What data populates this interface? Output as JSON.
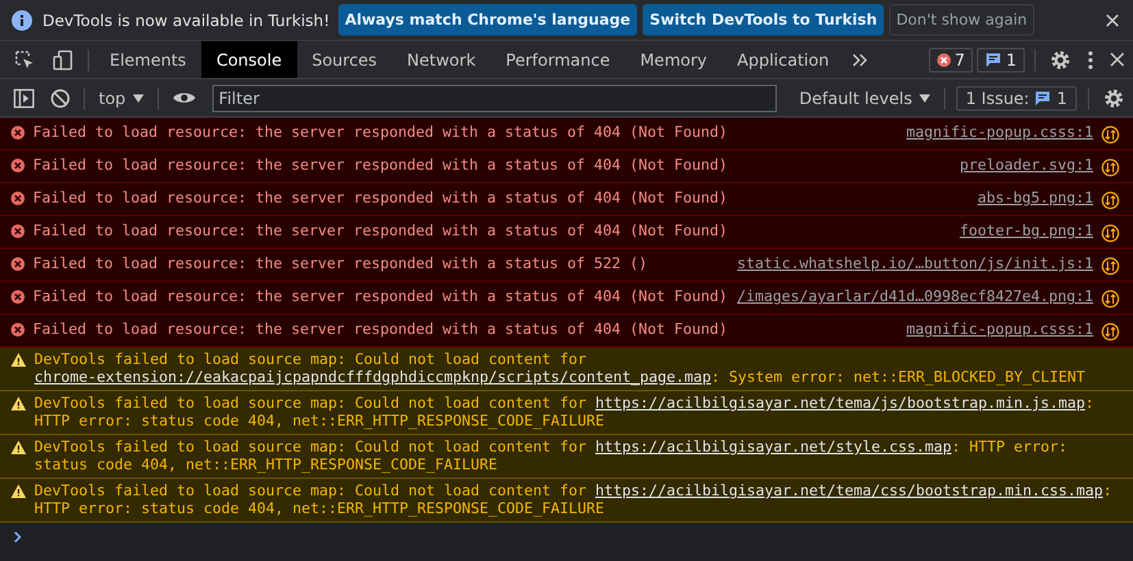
{
  "infobar": {
    "text": "DevTools is now available in Turkish!",
    "buttons": [
      {
        "label": "Always match Chrome's language",
        "kind": "primary"
      },
      {
        "label": "Switch DevTools to Turkish",
        "kind": "primary"
      },
      {
        "label": "Don't show again",
        "kind": "plain"
      }
    ]
  },
  "tabs": [
    {
      "label": "Elements",
      "selected": false
    },
    {
      "label": "Console",
      "selected": true
    },
    {
      "label": "Sources",
      "selected": false
    },
    {
      "label": "Network",
      "selected": false
    },
    {
      "label": "Performance",
      "selected": false
    },
    {
      "label": "Memory",
      "selected": false
    },
    {
      "label": "Application",
      "selected": false
    }
  ],
  "counters": {
    "errors": "7",
    "messages": "1"
  },
  "console_toolbar": {
    "context": "top",
    "filter_placeholder": "Filter",
    "levels": "Default levels",
    "issues_label": "1 Issue:",
    "issues_count": "1"
  },
  "messages": [
    {
      "kind": "error",
      "text": "Failed to load resource: the server responded with a status of 404 (Not Found)",
      "source": "magnific-popup.csss:1"
    },
    {
      "kind": "error",
      "text": "Failed to load resource: the server responded with a status of 404 (Not Found)",
      "source": "preloader.svg:1"
    },
    {
      "kind": "error",
      "text": "Failed to load resource: the server responded with a status of 404 (Not Found)",
      "source": "abs-bg5.png:1"
    },
    {
      "kind": "error",
      "text": "Failed to load resource: the server responded with a status of 404 (Not Found)",
      "source": "footer-bg.png:1"
    },
    {
      "kind": "error",
      "text": "Failed to load resource: the server responded with a status of 522 ()",
      "source": "static.whatshelp.io/…button/js/init.js:1"
    },
    {
      "kind": "error",
      "text": "Failed to load resource: the server responded with a status of 404 (Not Found)",
      "source": "/images/ayarlar/d41d…0998ecf8427e4.png:1"
    },
    {
      "kind": "error",
      "text": "Failed to load resource: the server responded with a status of 404 (Not Found)",
      "source": "magnific-popup.csss:1"
    },
    {
      "kind": "warning",
      "text": "DevTools failed to load source map: Could not load content for",
      "link": "chrome-extension://eakacpaijcpapndcfffdgphdiccmpknp/scripts/content_page.map",
      "tail": ": System error: net::ERR_BLOCKED_BY_CLIENT"
    },
    {
      "kind": "warning",
      "text": "DevTools failed to load source map: Could not load content for",
      "link": "https://acilbilgisayar.net/tema/js/bootstrap.min.js.map",
      "tail": ": HTTP error: status code 404, net::ERR_HTTP_RESPONSE_CODE_FAILURE"
    },
    {
      "kind": "warning",
      "text": "DevTools failed to load source map: Could not load content for",
      "link": "https://acilbilgisayar.net/style.css.map",
      "tail": ": HTTP error: status code 404, net::ERR_HTTP_RESPONSE_CODE_FAILURE"
    },
    {
      "kind": "warning",
      "text": "DevTools failed to load source map: Could not load content for",
      "link": "https://acilbilgisayar.net/tema/css/bootstrap.min.css.map",
      "tail": ": HTTP error: status code 404, net::ERR_HTTP_RESPONSE_CODE_FAILURE"
    }
  ]
}
